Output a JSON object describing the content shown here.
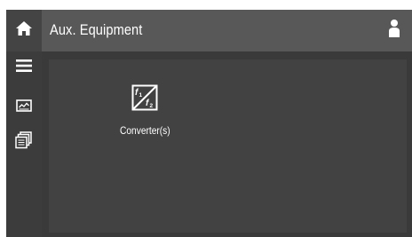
{
  "header": {
    "title": "Aux. Equipment",
    "home_icon": "home-icon",
    "user_icon": "user-icon"
  },
  "sidebar": {
    "items": [
      {
        "icon": "menu-icon"
      },
      {
        "icon": "chart-icon"
      },
      {
        "icon": "stacked-pages-icon"
      }
    ]
  },
  "main": {
    "tiles": [
      {
        "label": "Converter(s)",
        "icon": "frequency-converter-icon",
        "icon_text_1": "f1",
        "icon_text_2": "f2"
      }
    ]
  },
  "colors": {
    "header_bg": "#585858",
    "home_bg": "#444444",
    "frame_bg": "#3a3a3a",
    "content_bg": "#424242",
    "text": "#ffffff"
  }
}
